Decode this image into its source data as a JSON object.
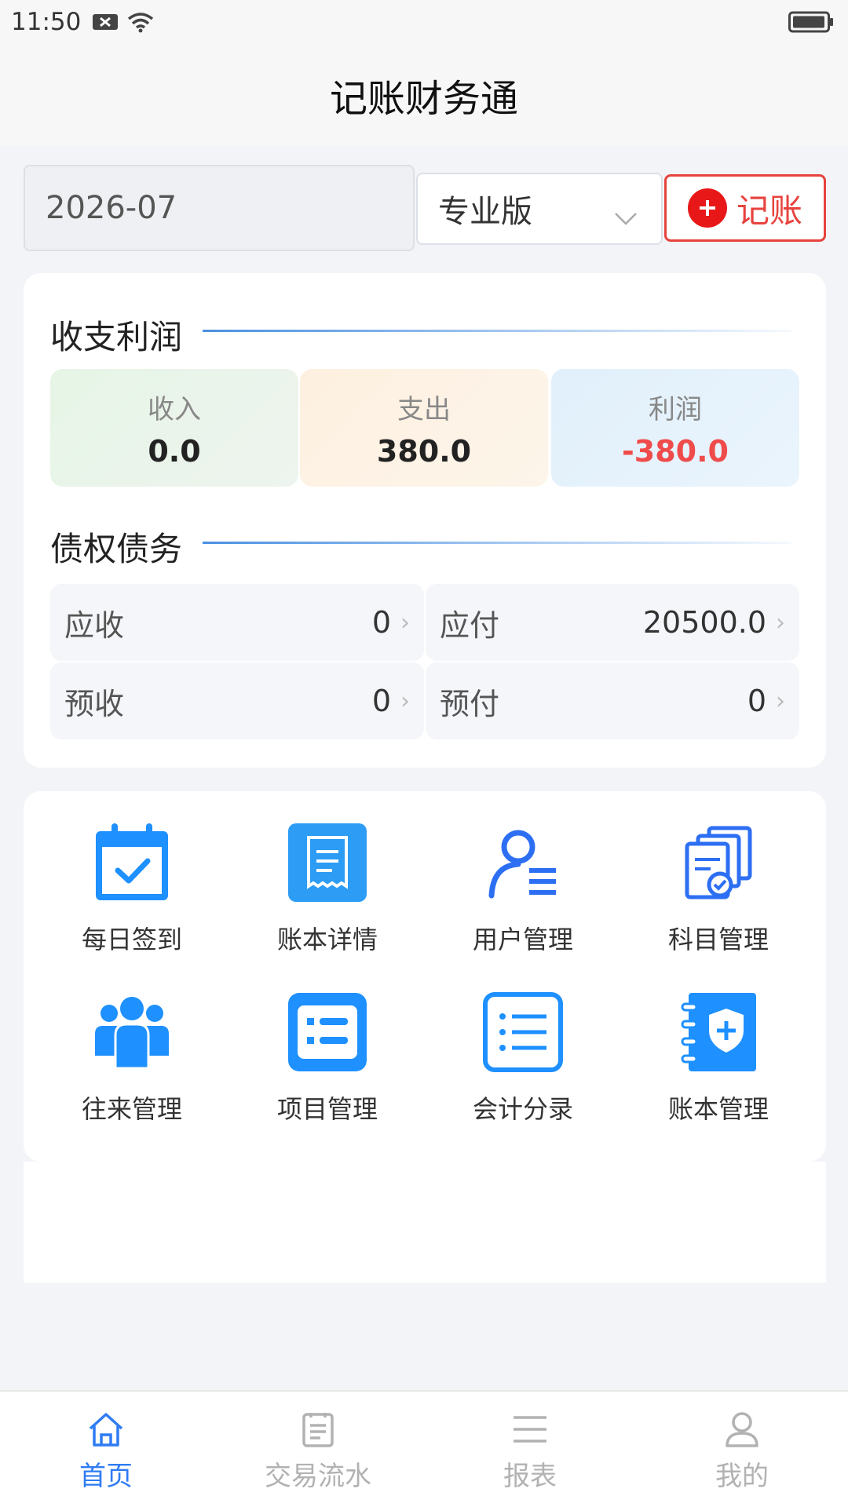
{
  "status_bar": {
    "time": "11:50"
  },
  "header": {
    "title": "记账财务通"
  },
  "toolbar": {
    "date_value": "2026-07",
    "version_select": "专业版",
    "add_label": "记账"
  },
  "finance": {
    "title": "收支利润",
    "income": {
      "label": "收入",
      "value": "0.0"
    },
    "expense": {
      "label": "支出",
      "value": "380.0"
    },
    "profit": {
      "label": "利润",
      "value": "-380.0"
    }
  },
  "debt": {
    "title": "债权债务",
    "receivable": {
      "label": "应收",
      "value": "0"
    },
    "payable": {
      "label": "应付",
      "value": "20500.0"
    },
    "advance_received": {
      "label": "预收",
      "value": "0"
    },
    "prepaid": {
      "label": "预付",
      "value": "0"
    }
  },
  "grid": {
    "items": [
      {
        "label": "每日签到",
        "icon": "calendar-check-icon"
      },
      {
        "label": "账本详情",
        "icon": "receipt-icon"
      },
      {
        "label": "用户管理",
        "icon": "user-list-icon"
      },
      {
        "label": "科目管理",
        "icon": "documents-check-icon"
      },
      {
        "label": "往来管理",
        "icon": "group-icon"
      },
      {
        "label": "项目管理",
        "icon": "list-box-icon"
      },
      {
        "label": "会计分录",
        "icon": "list-lines-icon"
      },
      {
        "label": "账本管理",
        "icon": "notebook-shield-icon"
      }
    ]
  },
  "tabbar": {
    "tabs": [
      {
        "label": "首页",
        "icon": "home-icon",
        "active": true
      },
      {
        "label": "交易流水",
        "icon": "document-icon",
        "active": false
      },
      {
        "label": "报表",
        "icon": "menu-icon",
        "active": false
      },
      {
        "label": "我的",
        "icon": "person-icon",
        "active": false
      }
    ]
  },
  "colors": {
    "accent": "#2f7cf3",
    "danger": "#e7433e",
    "icon_blue": "#1e90ff"
  }
}
